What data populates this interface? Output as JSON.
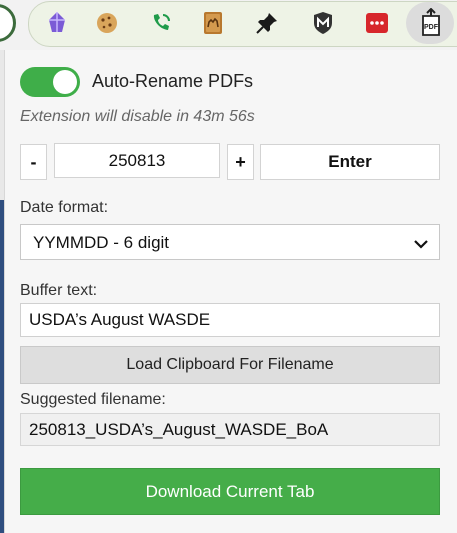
{
  "toolbar": {
    "extensions": [
      {
        "icon": "kite-icon"
      },
      {
        "icon": "cookie-icon"
      },
      {
        "icon": "phone-icon"
      },
      {
        "icon": "camel-book-icon"
      },
      {
        "icon": "pushpin-icon"
      },
      {
        "icon": "shield-m-icon"
      },
      {
        "icon": "red-dots-icon"
      },
      {
        "icon": "pdf-upload-icon",
        "label": "PDF"
      }
    ]
  },
  "popup": {
    "toggle": {
      "label": "Auto-Rename PDFs",
      "on": true,
      "color": "#3fae49"
    },
    "timer_note": "Extension will disable in 43m 56s",
    "date_controls": {
      "minus_label": "-",
      "value": "250813",
      "plus_label": "+",
      "enter_label": "Enter"
    },
    "date_format": {
      "label": "Date format:",
      "selected": "YYMMDD - 6 digit"
    },
    "buffer": {
      "label": "Buffer text:",
      "value": "USDA’s August WASDE"
    },
    "load_button_label": "Load Clipboard For Filename",
    "suggested": {
      "label": "Suggested filename:",
      "value": "250813_USDA’s_August_WASDE_BoA"
    },
    "download_button_label": "Download Current Tab",
    "download_color": "#45ad49"
  }
}
